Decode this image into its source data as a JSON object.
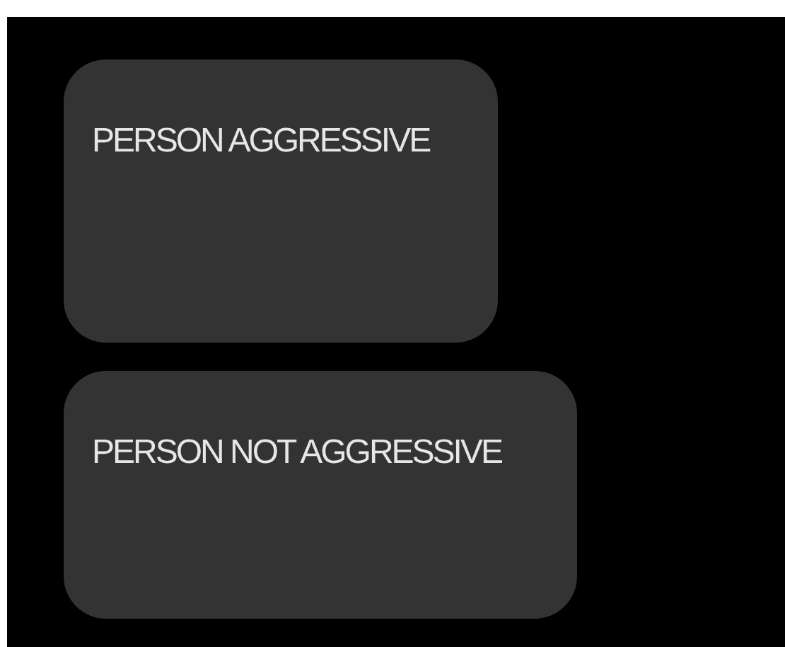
{
  "buttons": [
    {
      "label": "PERSON AGGRESSIVE"
    },
    {
      "label": "PERSON NOT AGGRESSIVE"
    }
  ]
}
